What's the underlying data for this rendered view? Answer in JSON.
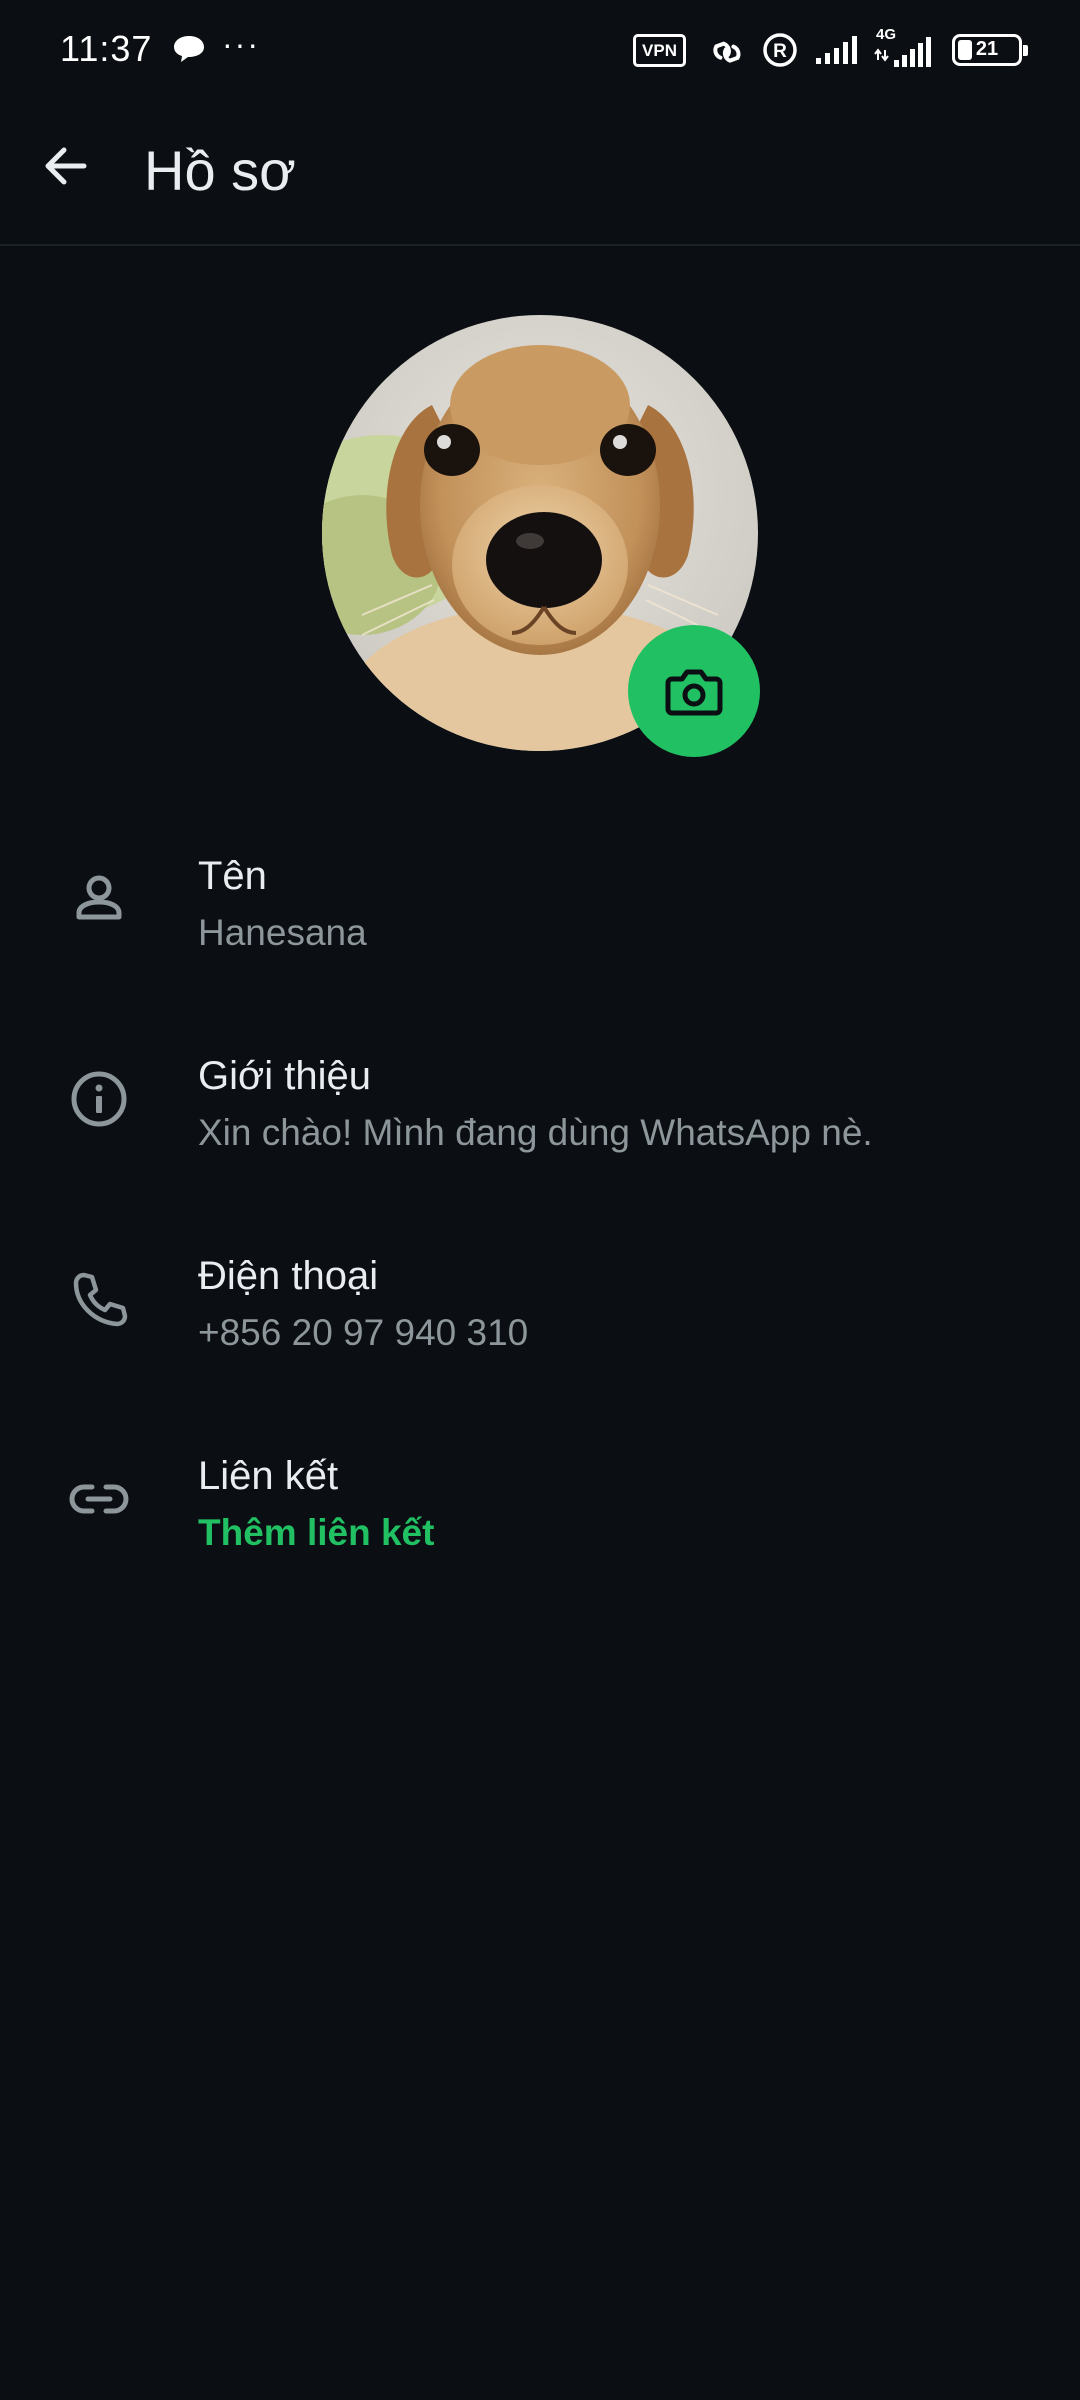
{
  "status_bar": {
    "time": "11:37",
    "more": "···",
    "vpn": "VPN",
    "network": "4G",
    "battery": "21",
    "icons": [
      "chat-bubble-icon",
      "vpn-icon",
      "link-icon",
      "roaming-icon",
      "signal-icon",
      "signal-4g-icon",
      "battery-icon"
    ]
  },
  "header": {
    "title": "Hồ sơ",
    "back_icon": "arrow-left-icon"
  },
  "profile": {
    "avatar_icon": "dog-photo",
    "camera_icon": "camera-icon",
    "accent": "#21c063"
  },
  "rows": [
    {
      "icon": "person-icon",
      "label": "Tên",
      "value": "Hanesana"
    },
    {
      "icon": "info-icon",
      "label": "Giới thiệu",
      "value": "Xin chào! Mình đang dùng WhatsApp nè."
    },
    {
      "icon": "phone-icon",
      "label": "Điện thoại",
      "value": "+856 20 97 940 310"
    },
    {
      "icon": "link-icon",
      "label": "Liên kết",
      "value": "Thêm liên kết"
    }
  ],
  "colors": {
    "background": "#0b0e13",
    "primary_text": "#e9edef",
    "secondary_text": "#8d969b",
    "accent": "#21c063"
  }
}
